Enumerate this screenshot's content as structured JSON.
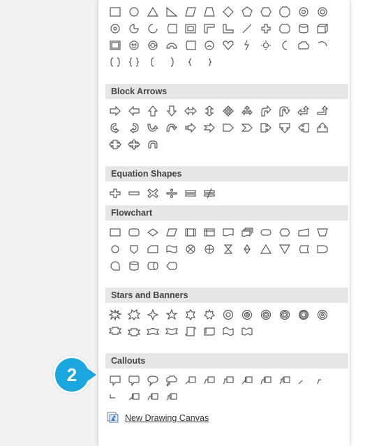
{
  "sections": [
    {
      "title": "Block Arrows"
    },
    {
      "title": "Equation Shapes"
    },
    {
      "title": "Flowchart"
    },
    {
      "title": "Stars and Banners"
    },
    {
      "title": "Callouts"
    }
  ],
  "footer": {
    "new_canvas_label": "New Drawing Canvas",
    "icon": "drawing-canvas-icon"
  },
  "annotation": {
    "step_number": "2",
    "color": "#1aa6df"
  },
  "colors": {
    "header_bg": "#e6e6e6",
    "shape_stroke": "#595959",
    "left_bg": "#f2f2f2"
  }
}
